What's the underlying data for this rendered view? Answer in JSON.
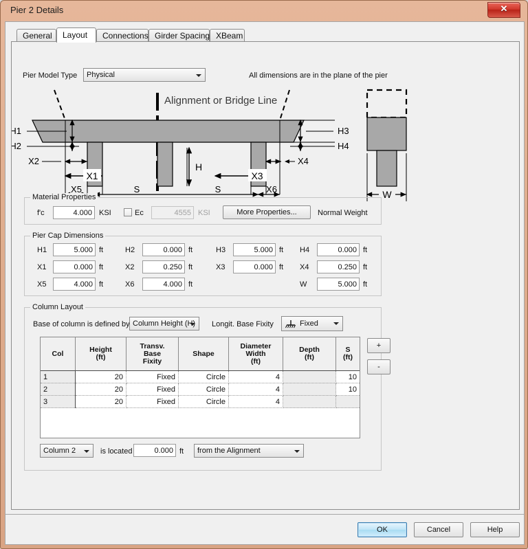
{
  "window": {
    "title": "Pier 2 Details",
    "close_label": "✕"
  },
  "tabs": [
    {
      "label": "General",
      "active": false
    },
    {
      "label": "Layout",
      "active": true
    },
    {
      "label": "Connections",
      "active": false
    },
    {
      "label": "Girder Spacing",
      "active": false
    },
    {
      "label": "XBeam",
      "active": false
    }
  ],
  "header": {
    "pier_model_type_label": "Pier Model Type",
    "pier_model_type_value": "Physical",
    "note": "All dimensions are in the plane of the pier"
  },
  "diagram": {
    "alignment_label": "Alignment or Bridge Line",
    "labels": {
      "h1": "H1",
      "h2": "H2",
      "h3": "H3",
      "h4": "H4",
      "x1": "X1",
      "x2": "X2",
      "x3": "X3",
      "x4": "X4",
      "x5": "X5",
      "x6": "X6",
      "s_left": "S",
      "s_right": "S",
      "h": "H",
      "w": "W"
    }
  },
  "material_properties": {
    "title": "Material Properties",
    "fc_label": "f'c",
    "fc_value": "4.000",
    "fc_unit": "KSI",
    "ec_label": "Ec",
    "ec_checked": false,
    "ec_value": "4555",
    "ec_unit": "KSI",
    "more_properties_label": "More Properties...",
    "weight_label": "Normal Weight"
  },
  "pier_cap_dimensions": {
    "title": "Pier Cap Dimensions",
    "unit": "ft",
    "fields": [
      {
        "label": "H1",
        "value": "5.000"
      },
      {
        "label": "H2",
        "value": "0.000"
      },
      {
        "label": "H3",
        "value": "5.000"
      },
      {
        "label": "H4",
        "value": "0.000"
      },
      {
        "label": "X1",
        "value": "0.000"
      },
      {
        "label": "X2",
        "value": "0.250"
      },
      {
        "label": "X3",
        "value": "0.000"
      },
      {
        "label": "X4",
        "value": "0.250"
      },
      {
        "label": "X5",
        "value": "4.000"
      },
      {
        "label": "X6",
        "value": "4.000"
      },
      {
        "label": "W",
        "value": "5.000"
      }
    ]
  },
  "column_layout": {
    "title": "Column Layout",
    "base_defined_by_label": "Base of column is defined by",
    "base_defined_by_value": "Column Height (H)",
    "longit_base_fixity_label": "Longit. Base Fixity",
    "longit_base_fixity_value": "Fixed",
    "add_button_label": "+",
    "remove_button_label": "-",
    "table": {
      "headers": [
        "Col",
        "Height\n(ft)",
        "Transv.\nBase\nFixity",
        "Shape",
        "Diameter\nWidth\n(ft)",
        "Depth\n(ft)",
        "S\n(ft)"
      ],
      "header_cells": [
        {
          "line1": "Col",
          "line2": "",
          "line3": ""
        },
        {
          "line1": "Height",
          "line2": "(ft)",
          "line3": ""
        },
        {
          "line1": "Transv.",
          "line2": "Base",
          "line3": "Fixity"
        },
        {
          "line1": "Shape",
          "line2": "",
          "line3": ""
        },
        {
          "line1": "Diameter",
          "line2": "Width",
          "line3": "(ft)"
        },
        {
          "line1": "Depth",
          "line2": "(ft)",
          "line3": ""
        },
        {
          "line1": "S",
          "line2": "(ft)",
          "line3": ""
        }
      ],
      "rows": [
        {
          "col": "1",
          "height": "20",
          "transv_base_fixity": "Fixed",
          "shape": "Circle",
          "diameter_width": "4",
          "depth": "",
          "s": "10"
        },
        {
          "col": "2",
          "height": "20",
          "transv_base_fixity": "Fixed",
          "shape": "Circle",
          "diameter_width": "4",
          "depth": "",
          "s": "10"
        },
        {
          "col": "3",
          "height": "20",
          "transv_base_fixity": "Fixed",
          "shape": "Circle",
          "diameter_width": "4",
          "depth": "",
          "s": ""
        }
      ]
    },
    "locator": {
      "column_value": "Column 2",
      "is_located_label": "is located",
      "distance_value": "0.000",
      "distance_unit": "ft",
      "reference_value": "from the Alignment"
    }
  },
  "footer": {
    "ok_label": "OK",
    "cancel_label": "Cancel",
    "help_label": "Help"
  }
}
